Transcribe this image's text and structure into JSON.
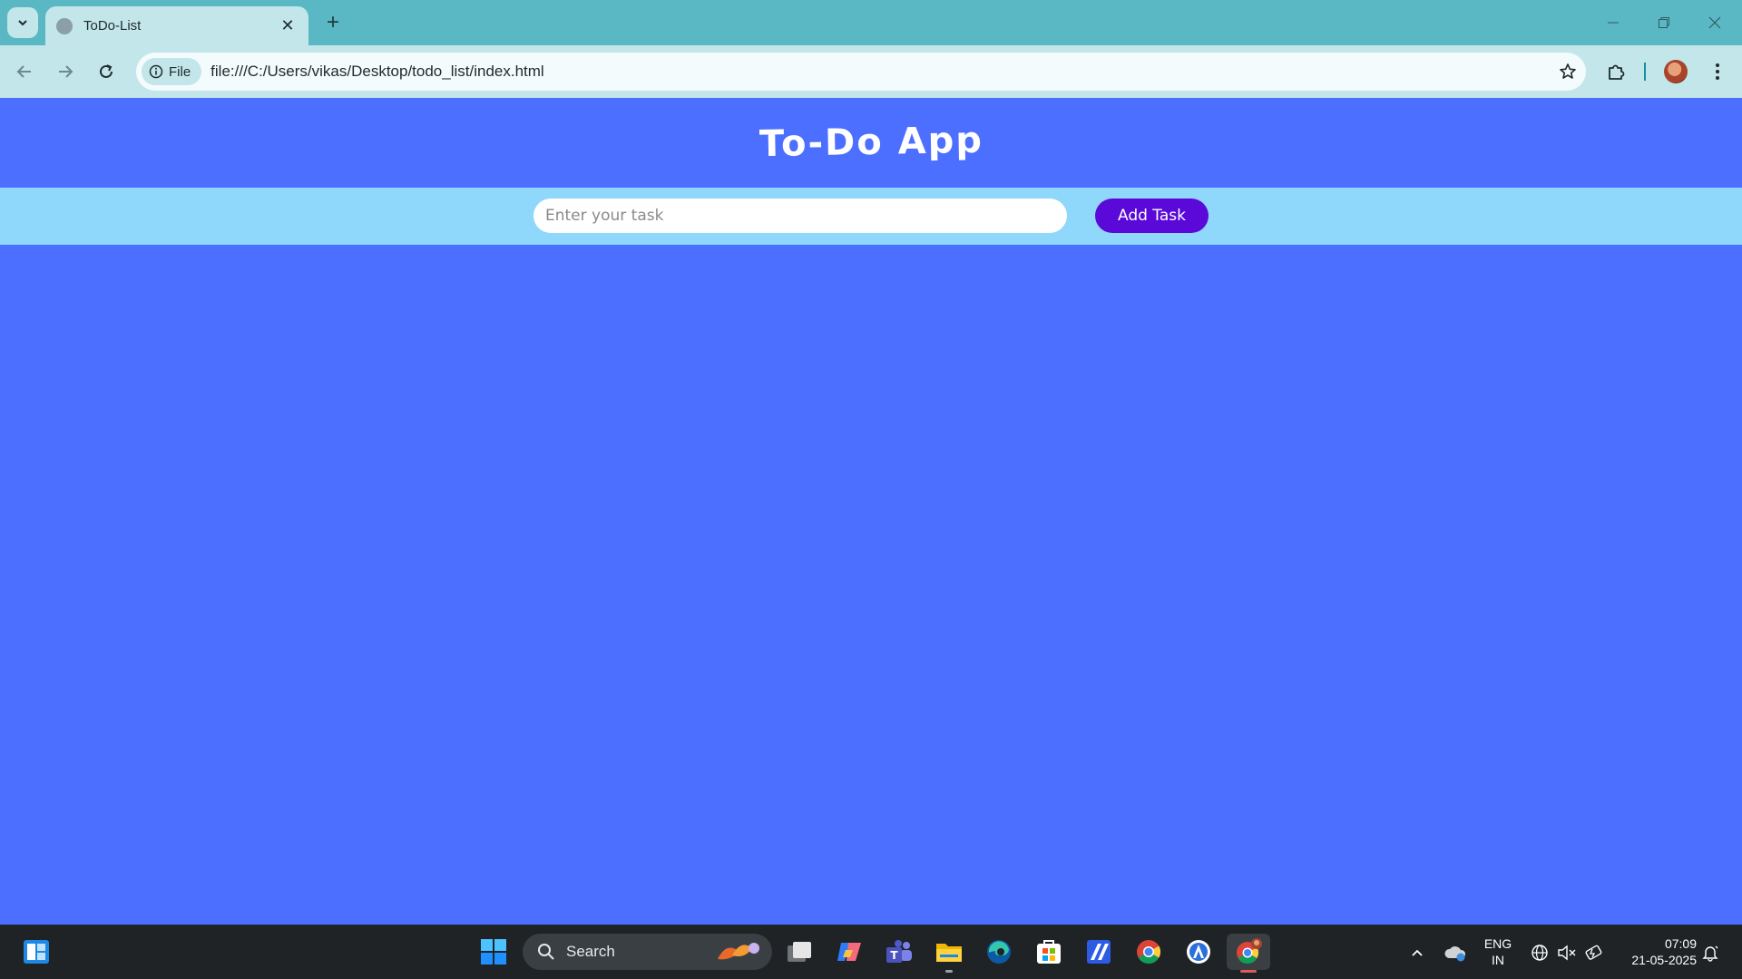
{
  "browser": {
    "tab": {
      "title": "ToDo-List"
    },
    "address_bar": {
      "scheme_chip": "File",
      "url": "file:///C:/Users/vikas/Desktop/todo_list/index.html"
    }
  },
  "app": {
    "title": "To-Do App",
    "input": {
      "placeholder": "Enter your task",
      "value": ""
    },
    "add_button_label": "Add Task",
    "tasks": []
  },
  "colors": {
    "page_background": "#4c6fff",
    "input_bar_background": "#8fd8fb",
    "button_background": "#5a09d9",
    "tabstrip": "#5ab8c4",
    "toolbar": "#c2e6ea"
  },
  "taskbar": {
    "search_label": "Search",
    "language": {
      "line1": "ENG",
      "line2": "IN"
    },
    "clock": {
      "time": "07:09",
      "date": "21-05-2025"
    },
    "apps": [
      "widgets-icon",
      "start-icon",
      "task-view-icon",
      "copilot-icon",
      "teams-icon",
      "file-explorer-icon",
      "edge-icon",
      "store-icon",
      "app-icon",
      "chrome-icon",
      "app-icon",
      "chrome-profile-icon"
    ]
  }
}
